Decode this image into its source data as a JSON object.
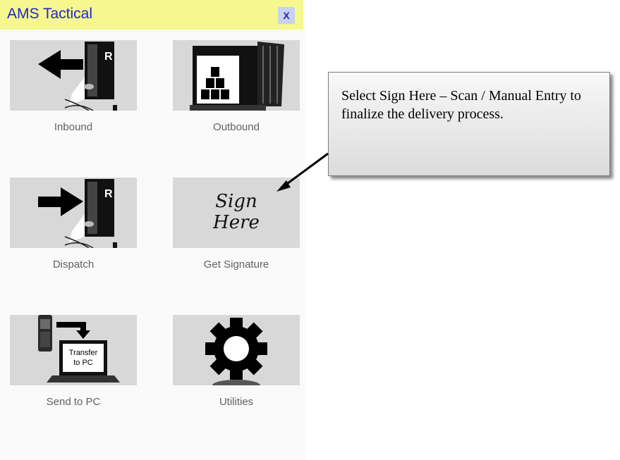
{
  "app": {
    "title": "AMS Tactical",
    "close_label": "X"
  },
  "tiles": [
    {
      "label": "Inbound",
      "icon": "inbound-truck-icon"
    },
    {
      "label": "Outbound",
      "icon": "outbound-container-icon"
    },
    {
      "label": "Dispatch",
      "icon": "dispatch-truck-icon"
    },
    {
      "label": "Get Signature",
      "icon": "sign-here-icon",
      "icon_text": [
        "Sign",
        "Here"
      ]
    },
    {
      "label": "Send to PC",
      "icon": "transfer-to-pc-icon",
      "icon_text": [
        "Transfer",
        "to PC"
      ]
    },
    {
      "label": "Utilities",
      "icon": "gear-icon"
    }
  ],
  "callout": {
    "text": "Select Sign Here – Scan / Manual Entry to finalize the delivery process."
  },
  "colors": {
    "title_bar": "#f6f78e",
    "title_text": "#1f27c6",
    "tile_bg": "#d8d8d8",
    "label_text": "#606060"
  }
}
